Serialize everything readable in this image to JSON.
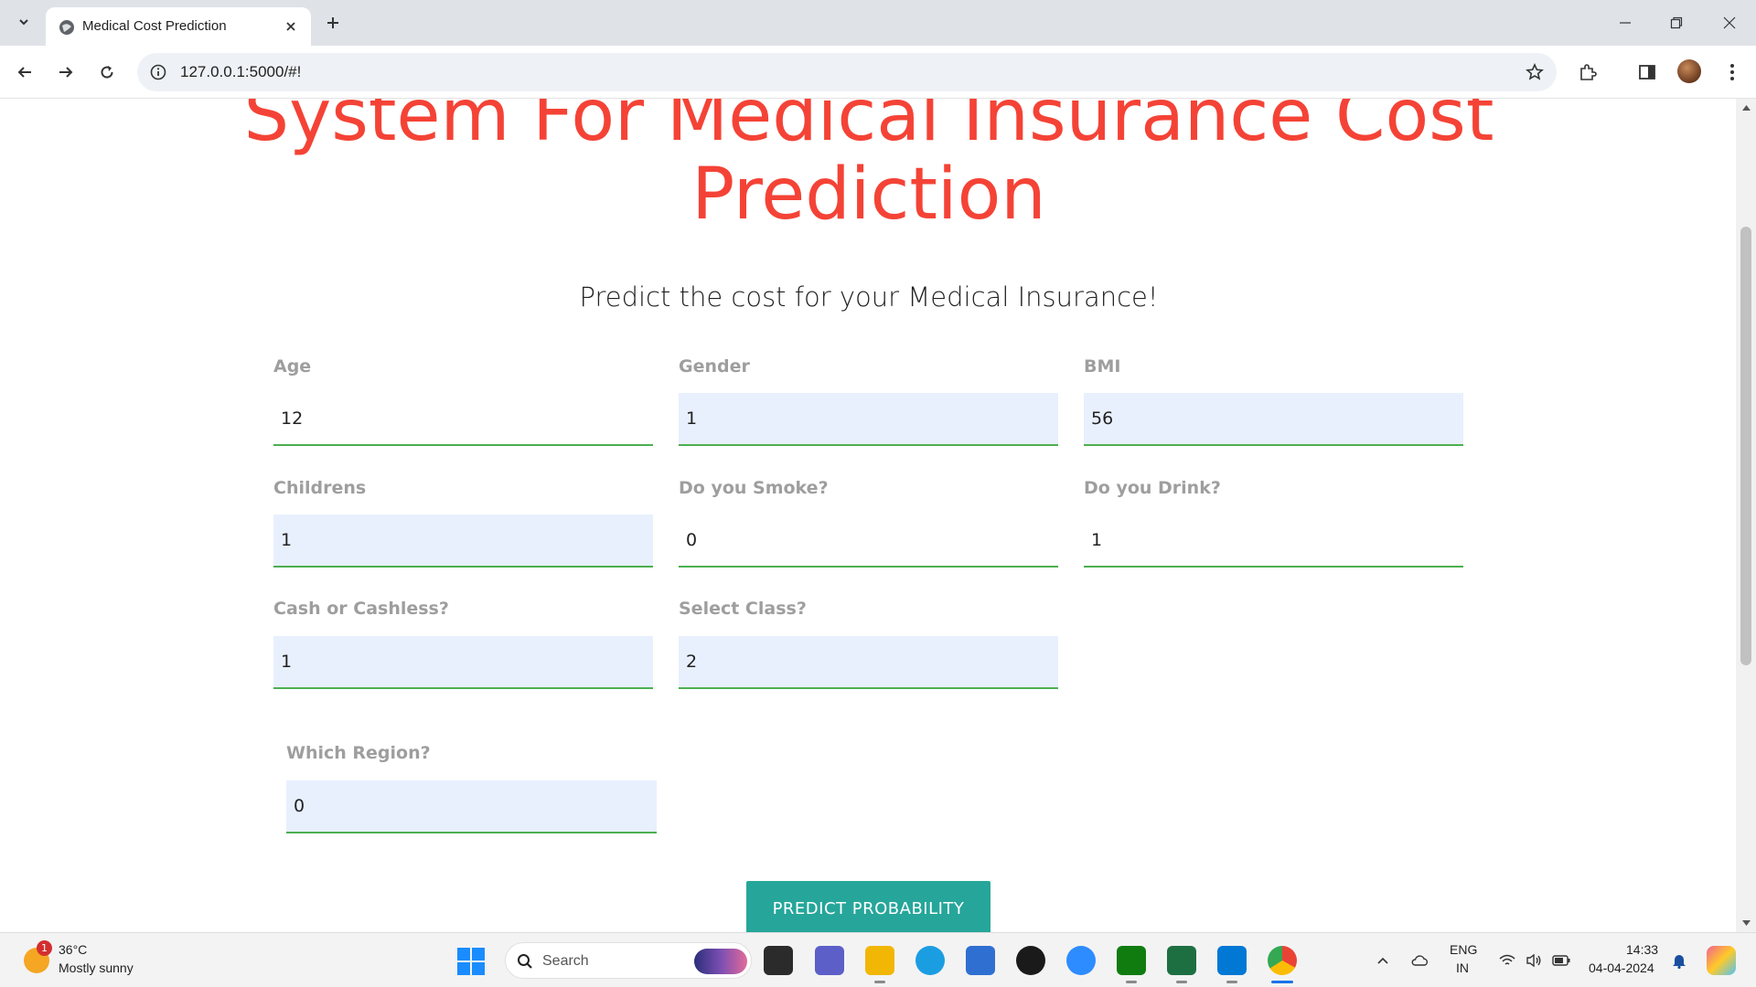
{
  "browser": {
    "tab_title": "Medical Cost Prediction",
    "url": "127.0.0.1:5000/#!"
  },
  "page": {
    "title": "System For Medical Insurance Cost Prediction",
    "subtitle": "Predict the cost for your Medical Insurance!",
    "fields": [
      {
        "label": "Age",
        "value": "12"
      },
      {
        "label": "Gender",
        "value": "1"
      },
      {
        "label": "BMI",
        "value": "56"
      },
      {
        "label": "Childrens",
        "value": "1"
      },
      {
        "label": "Do you Smoke?",
        "value": "0"
      },
      {
        "label": "Do you Drink?",
        "value": "1"
      },
      {
        "label": "Cash or Cashless?",
        "value": "1"
      },
      {
        "label": "Select Class?",
        "value": "2"
      },
      {
        "label": "Which Region?",
        "value": "0"
      }
    ],
    "predict_button": "PREDICT PROBABILITY"
  },
  "taskbar": {
    "weather_badge": "1",
    "temperature": "36°C",
    "weather": "Mostly sunny",
    "search_placeholder": "Search",
    "apps": [
      "file-explorer-icon",
      "teams-icon",
      "folder-icon",
      "edge-icon",
      "store-icon",
      "dell-icon",
      "zoom-icon",
      "xbox-icon",
      "excel-icon",
      "vscode-icon",
      "chrome-icon"
    ],
    "lang_top": "ENG",
    "lang_bottom": "IN",
    "time": "14:33",
    "date": "04-04-2024"
  },
  "colors": {
    "title": "#f44336",
    "accent_button": "#26a69a",
    "field_underline": "#4caf50",
    "field_fill": "#e8f0fe",
    "label": "#9e9e9e"
  }
}
